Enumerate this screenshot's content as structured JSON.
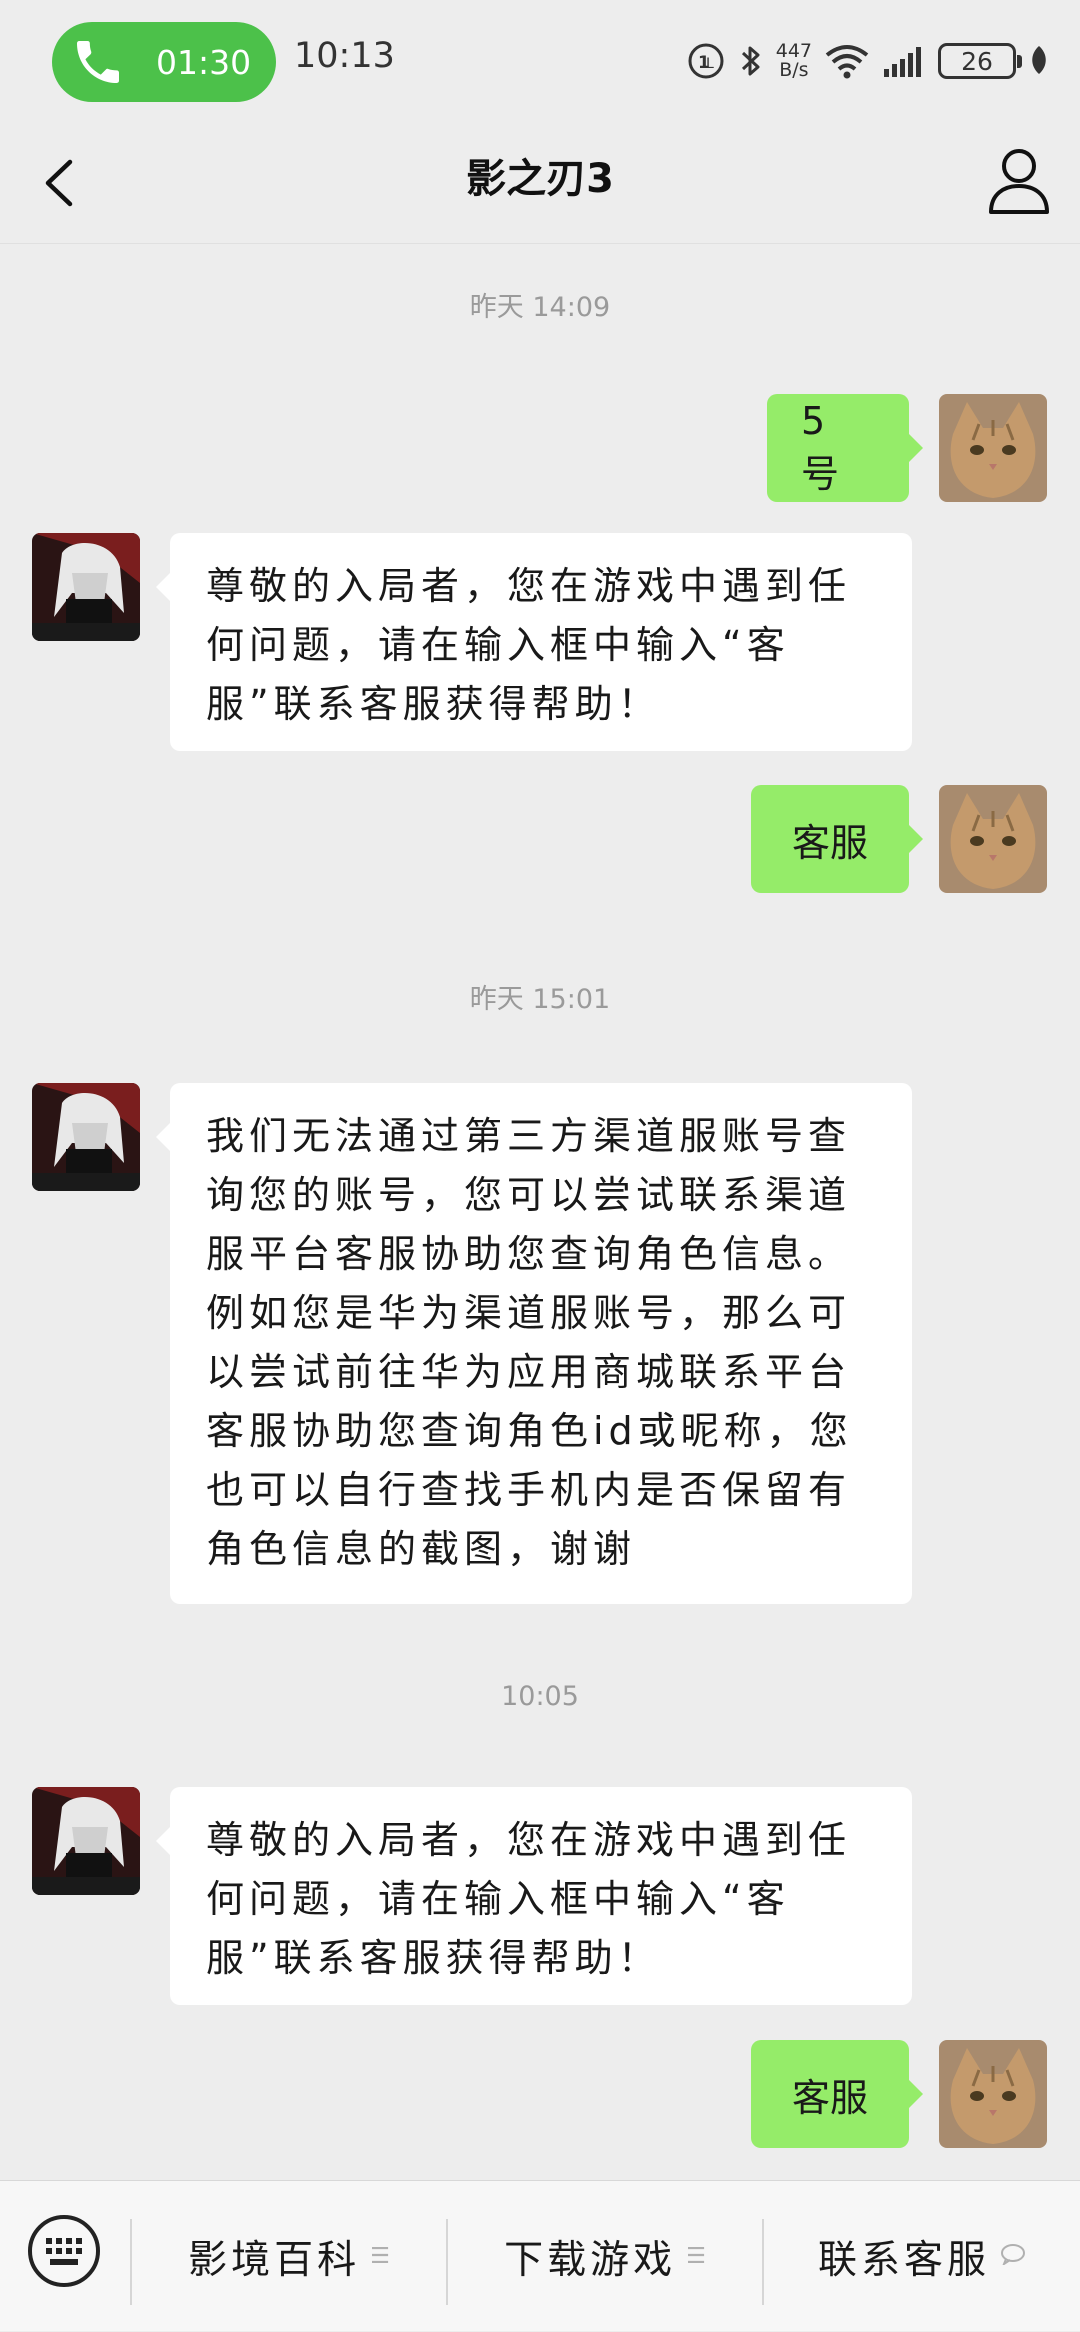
{
  "status_bar": {
    "call_timer": "01:30",
    "time": "10:13",
    "net_speed_value": "447",
    "net_speed_unit": "B/s",
    "battery": "26"
  },
  "nav": {
    "title": "影之刃3"
  },
  "messages": [
    {
      "type": "timestamp",
      "text": "昨天 14:09"
    },
    {
      "type": "sent",
      "text": "5 号"
    },
    {
      "type": "received",
      "text": "尊敬的入局者，您在游戏中遇到任何问题，请在输入框中输入“客服”联系客服获得帮助！"
    },
    {
      "type": "sent",
      "text": "客服"
    },
    {
      "type": "timestamp",
      "text": "昨天 15:01"
    },
    {
      "type": "received",
      "text": "我们无法通过第三方渠道服账号查询您的账号，您可以尝试联系渠道服平台客服协助您查询角色信息。例如您是华为渠道服账号，那么可以尝试前往华为应用商城联系平台客服协助您查询角色id或昵称，您也可以自行查找手机内是否保留有角色信息的截图，谢谢"
    },
    {
      "type": "timestamp",
      "text": "10:05"
    },
    {
      "type": "received",
      "text": "尊敬的入局者，您在游戏中遇到任何问题，请在输入框中输入“客服”联系客服获得帮助！"
    },
    {
      "type": "sent",
      "text": "客服"
    }
  ],
  "bottom_menu": {
    "items": [
      {
        "label": "影境百科",
        "icon": "menu-lines-icon"
      },
      {
        "label": "下载游戏",
        "icon": "menu-lines-icon"
      },
      {
        "label": "联系客服",
        "icon": "chat-bubble-icon"
      }
    ]
  },
  "colors": {
    "sent_bubble": "#95ec69",
    "received_bubble": "#ffffff",
    "call_pill": "#4cc14a",
    "background": "#ededed"
  }
}
